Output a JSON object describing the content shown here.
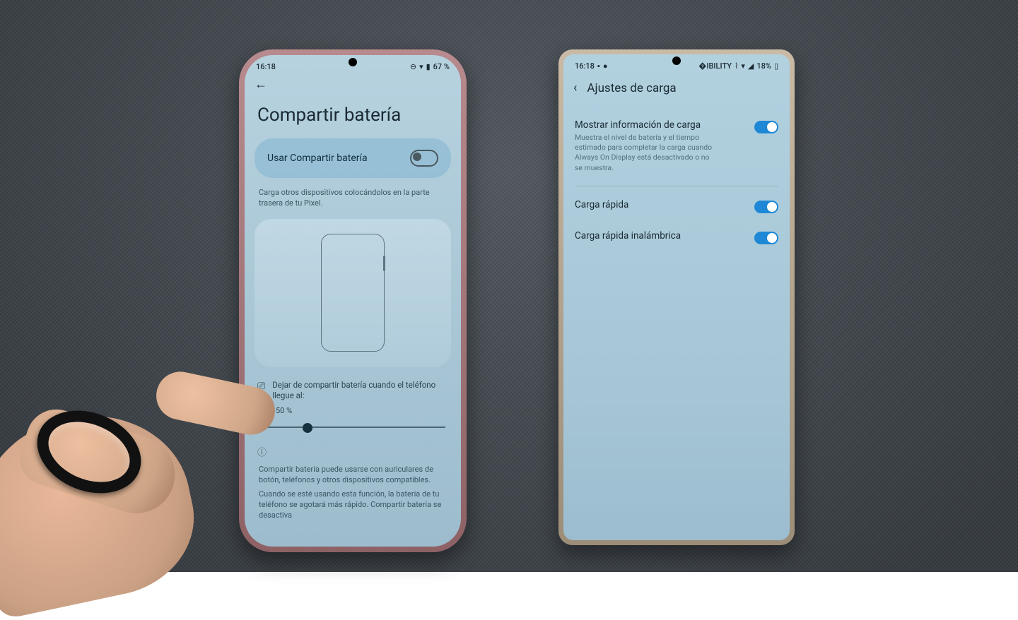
{
  "left": {
    "status": {
      "time": "16:18",
      "battery_text": "67 %"
    },
    "title": "Compartir batería",
    "share_card": {
      "label": "Usar Compartir batería",
      "enabled": false
    },
    "description": "Carga otros dispositivos colocándolos en la parte trasera de tu Pixel.",
    "threshold": {
      "label": "Dejar de compartir batería cuando el teléfono llegue al:",
      "value_text": "50 %",
      "value_pct": 50
    },
    "footer1": "Compartir batería puede usarse con auriculares de botón, teléfonos y otros dispositivos compatibles.",
    "footer2": "Cuando se esté usando esta función, la batería de tu teléfono se agotará más rápido. Compartir batería se desactiva"
  },
  "right": {
    "status": {
      "time": "16:18",
      "battery_text": "18%"
    },
    "title": "Ajustes de carga",
    "options": [
      {
        "title": "Mostrar información de carga",
        "subtitle": "Muestra el nivel de batería y el tiempo estimado para completar la carga cuando Always On Display está desactivado o no se muestra.",
        "enabled": true
      },
      {
        "title": "Carga rápida",
        "subtitle": "",
        "enabled": true
      },
      {
        "title": "Carga rápida inalámbrica",
        "subtitle": "",
        "enabled": true
      }
    ]
  }
}
